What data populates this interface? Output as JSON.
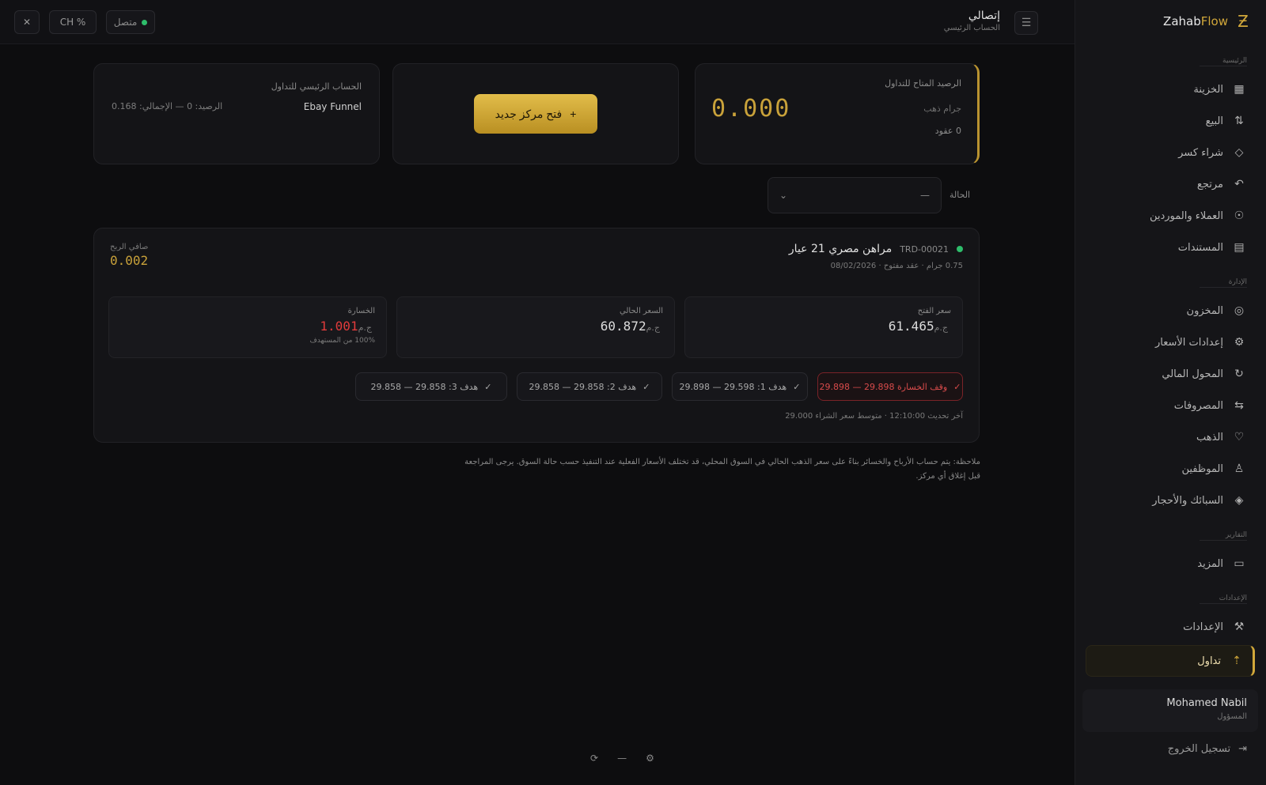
{
  "topbar": {
    "close_icon": "close-icon",
    "percent_label": "CH %",
    "status_label": "متصل",
    "page_title": "إتصالي",
    "page_subtitle": "الحساب الرئيسي"
  },
  "sidebar": {
    "brand_prefix": "Zahab",
    "brand_suffix": "Flow",
    "sections": [
      {
        "head": "الرئيسية"
      },
      {
        "head": "الإدارة"
      },
      {
        "head": "التقارير"
      },
      {
        "head": "الإعدادات"
      }
    ],
    "items": [
      {
        "label": "الخزينة",
        "icon": "▦"
      },
      {
        "label": "البيع",
        "icon": "⇅"
      },
      {
        "label": "شراء كسر",
        "icon": "◇"
      },
      {
        "label": "مرتجع",
        "icon": "↶"
      },
      {
        "label": "العملاء والموردين",
        "icon": "☉"
      },
      {
        "label": "المستندات",
        "icon": "▤"
      },
      {
        "label": "المخزون",
        "icon": "◎"
      },
      {
        "label": "إعدادات الأسعار",
        "icon": "⚙"
      },
      {
        "label": "المحول المالي",
        "icon": "↻"
      },
      {
        "label": "المصروفات",
        "icon": "⇆"
      },
      {
        "label": "الذهب",
        "icon": "♡"
      },
      {
        "label": "الموظفين",
        "icon": "♙"
      },
      {
        "label": "السبائك والأحجار",
        "icon": "◈"
      },
      {
        "label": "المزيد",
        "icon": "▭"
      },
      {
        "label": "الإعدادات",
        "icon": "⚒"
      },
      {
        "label": "تداول",
        "icon": "⇡"
      }
    ],
    "user_name": "Mohamed Nabil",
    "user_role": "المسؤول",
    "logout_label": "تسجيل الخروج"
  },
  "kpi": {
    "balance_label": "الرصيد المتاح للتداول",
    "balance_currency": "جرام ذهب",
    "balance_value": "0.000",
    "balance_sub": "0 عقود",
    "cta_label": "فتح مركز جديد",
    "trade_label": "الحساب الرئيسي للتداول",
    "trade_account": "Ebay Funnel",
    "trade_meta": "الرصيد: 0 — الإجمالي: 0.168"
  },
  "filter": {
    "label": "الحالة",
    "value": "—"
  },
  "position": {
    "title": "مراهن مصري 21 عيار",
    "id": "TRD-00021",
    "sub": "0.75 جرام · عقد مفتوح · 08/02/2026",
    "pl_label": "صافي الربح",
    "pl_value": "0.002",
    "open_label": "سعر الفتح",
    "open_value": "61.465",
    "current_label": "السعر الحالي",
    "current_value": "60.872",
    "currency": "ج.م",
    "loss_label": "الخسارة",
    "loss_value": "1.001",
    "loss_sub": "100% من المستهدف",
    "targets": [
      {
        "label": "وقف الخسارة 29.898 — 29.898"
      },
      {
        "label": "هدف 1: 29.598 — 29.898"
      },
      {
        "label": "هدف 2: 29.858 — 29.858"
      },
      {
        "label": "هدف 3: 29.858 — 29.858"
      }
    ],
    "footer": "آخر تحديث 12:10:00 · متوسط سعر الشراء 29.000"
  },
  "note": "ملاحظة: يتم حساب الأرباح والخسائر بناءً على سعر الذهب الحالي في السوق المحلي، قد تختلف الأسعار الفعلية عند التنفيذ حسب حالة السوق. يرجى المراجعة قبل إغلاق أي مركز.",
  "bottom": {
    "a": "⟳",
    "b": "—",
    "c": "⚙"
  }
}
